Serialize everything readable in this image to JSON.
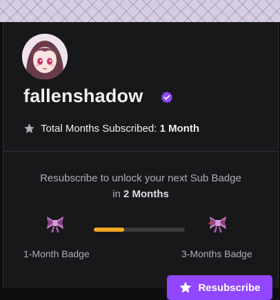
{
  "user": {
    "username": "fallenshadow",
    "avatar_icon": "anime-avatar",
    "verified_icon": "verified-badge-icon"
  },
  "subscription": {
    "total_label": "Total Months Subscribed:",
    "total_value": "1 Month"
  },
  "resubscribe": {
    "message": "Resubscribe to unlock your next Sub Badge",
    "in_prefix": "in",
    "months_value": "2 Months",
    "progress": 0.33,
    "current_badge_label": "1-Month Badge",
    "next_badge_label": "3-Months Badge",
    "badge_icon": "pink-bow-icon",
    "button_label": "Resubscribe",
    "button_icon": "star-icon"
  },
  "colors": {
    "accent": "#9147ff",
    "progress_fill": "#f9a825",
    "background": "#18181b"
  }
}
